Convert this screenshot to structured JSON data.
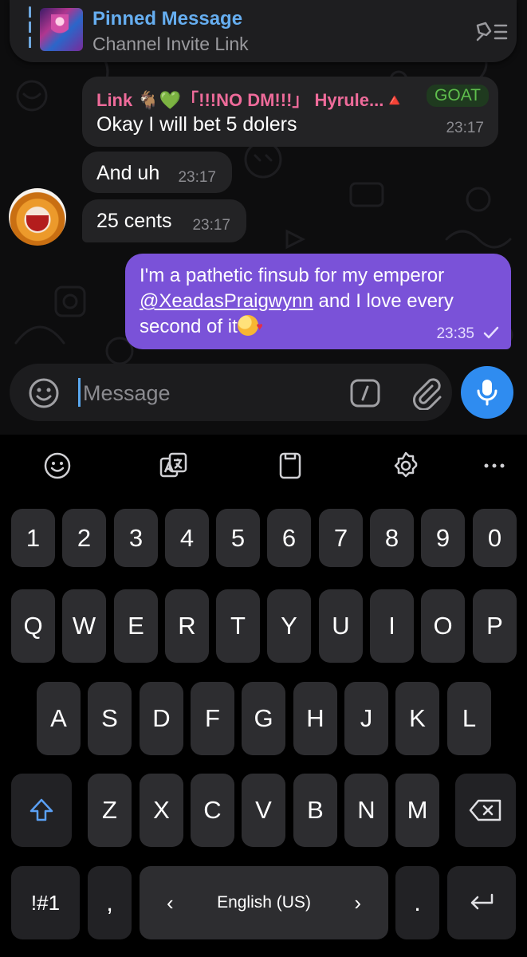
{
  "pinned": {
    "title": "Pinned Message",
    "subtitle": "Channel Invite Link"
  },
  "messages": {
    "m1": {
      "sender": "Link 🐐💚「!!!NO DM!!!」 Hyrule...🔺",
      "badge": "GOAT",
      "text": "Okay I will bet 5 dolers",
      "time": "23:17"
    },
    "m2": {
      "text": "And uh",
      "time": "23:17"
    },
    "m3": {
      "text": "25 cents",
      "time": "23:17"
    },
    "m4": {
      "text_before": "I'm a pathetic finsub for my emperor ",
      "mention": "@XeadasPraigwynn",
      "text_after": " and I love every second of it",
      "time": "23:35"
    }
  },
  "composer": {
    "placeholder": "Message"
  },
  "keyboard": {
    "row_numbers": [
      "1",
      "2",
      "3",
      "4",
      "5",
      "6",
      "7",
      "8",
      "9",
      "0"
    ],
    "row_top": [
      "Q",
      "W",
      "E",
      "R",
      "T",
      "Y",
      "U",
      "I",
      "O",
      "P"
    ],
    "row_middle": [
      "A",
      "S",
      "D",
      "F",
      "G",
      "H",
      "J",
      "K",
      "L"
    ],
    "row_bottom": [
      "Z",
      "X",
      "C",
      "V",
      "B",
      "N",
      "M"
    ],
    "symbols_key": "!#1",
    "comma_key": ",",
    "period_key": ".",
    "space_label": "English (US)",
    "space_left": "‹",
    "space_right": "›"
  },
  "colors": {
    "accent": "#66aef0",
    "outgoing_bubble": "#7a52d8",
    "incoming_bubble": "#232325",
    "sender_name": "#ee6b9a",
    "badge_text": "#5fbf4d",
    "mic_button": "#2f8cf0",
    "shift_active": "#5aa0f5"
  }
}
